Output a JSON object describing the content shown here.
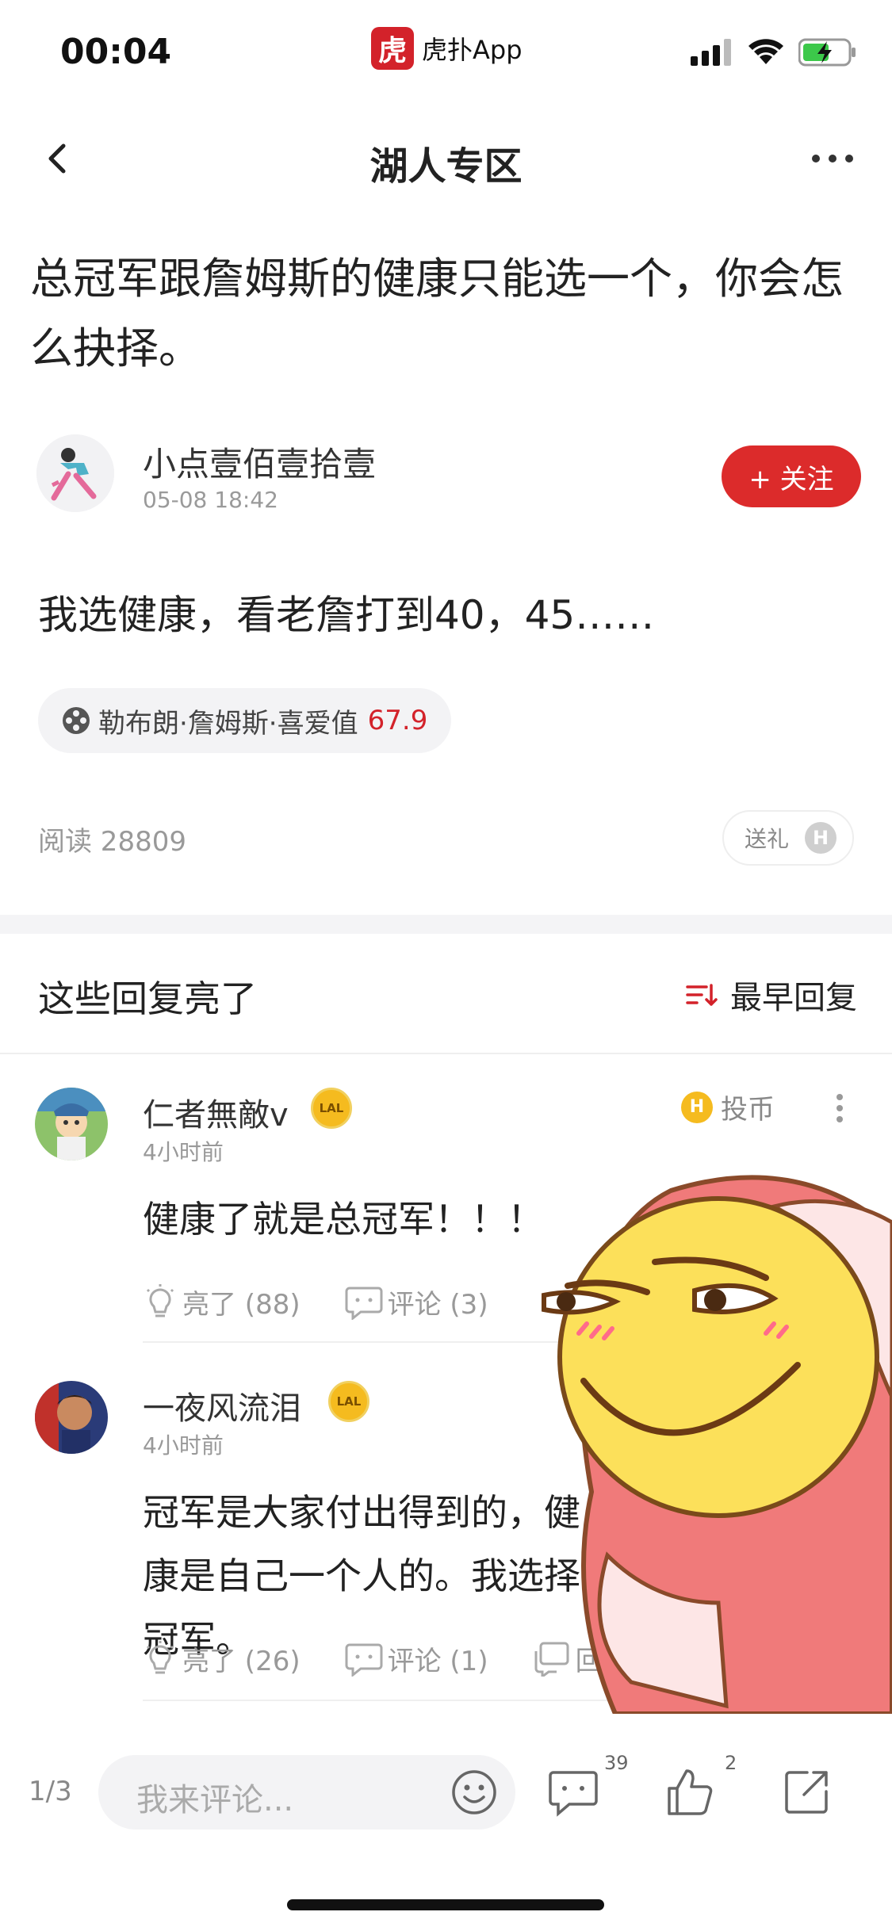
{
  "status_bar": {
    "time": "00:04",
    "app_name": "虎扑App",
    "app_logo_char": "虎"
  },
  "nav": {
    "title": "湖人专区"
  },
  "post": {
    "title": "总冠军跟詹姆斯的健康只能选一个，你会怎么抉择。",
    "author": "小点壹佰壹拾壹",
    "time": "05-08 18:42",
    "follow_label": "+ 关注",
    "body": "我选健康，看老詹打到40，45……",
    "tag_label": "勒布朗·詹姆斯·喜爱值",
    "tag_score": "67.9",
    "read_label": "阅读 28809",
    "gift_label": "送礼",
    "coin_letter": "H"
  },
  "replies_section": {
    "title": "这些回复亮了",
    "sort_label": "最早回复"
  },
  "replies": [
    {
      "name": "仁者無敵v",
      "badge": "LAL",
      "time": "4小时前",
      "text": "健康了就是总冠军！！！",
      "light_label": "亮了 (88)",
      "comment_label": "评论 (3)",
      "coin_label": "投币",
      "coin_letter": "H"
    },
    {
      "name": "一夜风流泪",
      "badge": "LAL",
      "time": "4小时前",
      "text": "冠军是大家付出得到的，健康是自己一个人的。我选择冠军。",
      "light_label": "亮了 (26)",
      "comment_label": "评论 (1)",
      "reply_label": "回"
    }
  ],
  "bottom_bar": {
    "page_indicator": "1/3",
    "comment_placeholder": "我来评论...",
    "comment_count": "39",
    "like_count": "2"
  },
  "colors": {
    "accent": "#dc2b2b",
    "badge": "#f5bb1f"
  }
}
